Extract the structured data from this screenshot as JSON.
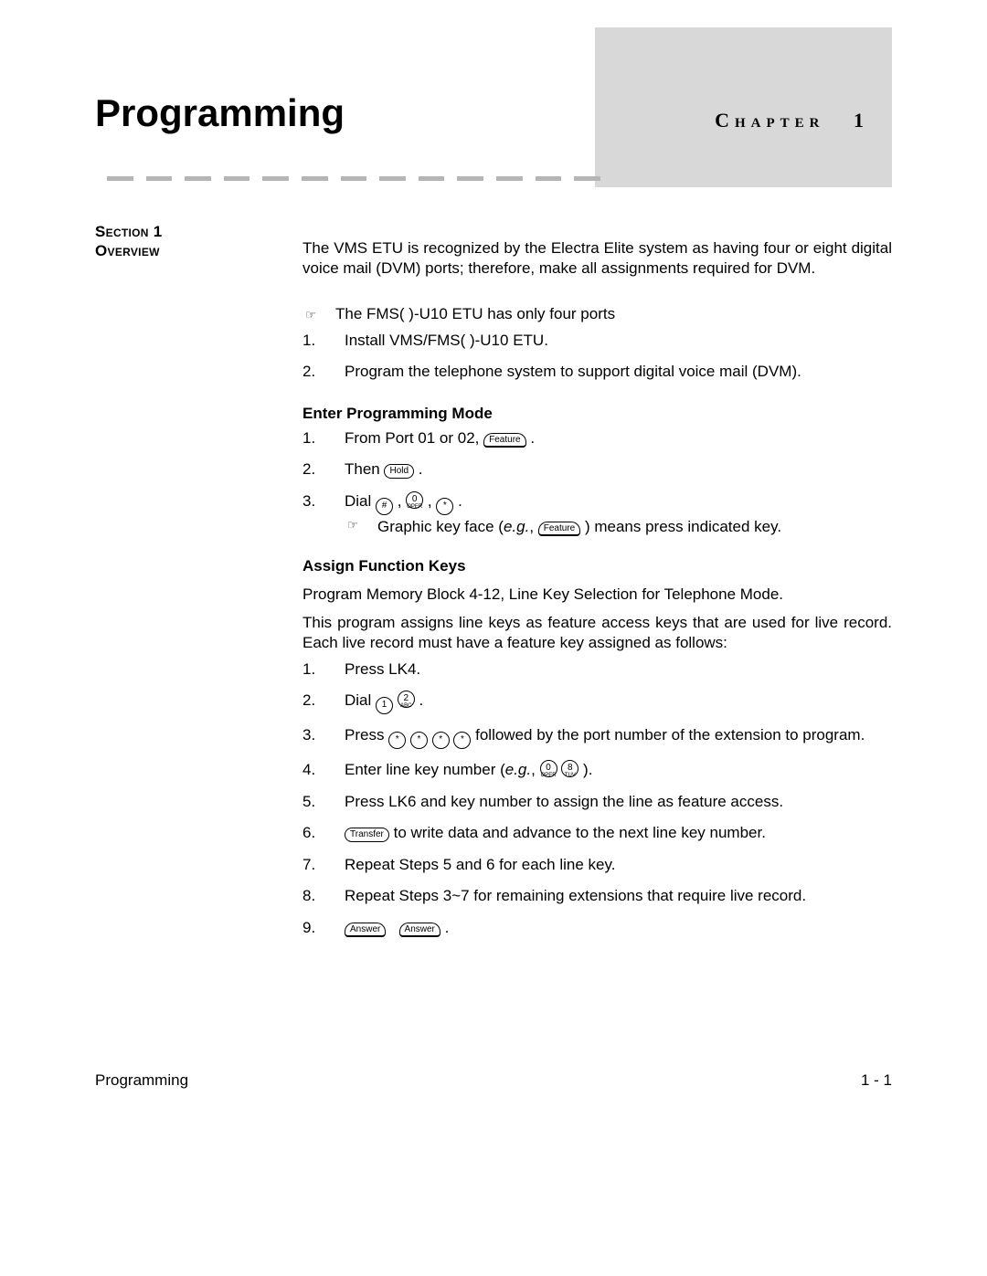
{
  "header": {
    "title": "Programming",
    "chapter_label": "Chapter",
    "chapter_number": "1"
  },
  "section": {
    "label": "Section 1",
    "name": "Overview"
  },
  "overview_para": "The VMS ETU is recognized by the Electra Elite system as having four or eight digital voice mail (DVM) ports; therefore, make all assignments required for DVM.",
  "note1": "The FMS( )-U10 ETU has only four ports",
  "list1": {
    "items": [
      {
        "n": "1.",
        "t": "Install VMS/FMS( )-U10 ETU."
      },
      {
        "n": "2.",
        "t": "Program the telephone system to support digital voice mail (DVM)."
      }
    ]
  },
  "enter_mode_heading": "Enter Programming Mode",
  "list2": {
    "items": [
      {
        "n": "1.",
        "pre": "From Port 01 or 02, ",
        "key": "Feature",
        "post": "."
      },
      {
        "n": "2.",
        "pre": "Then ",
        "key": "Hold",
        "post": "."
      },
      {
        "n": "3.",
        "pre": "Dial ",
        "keys": [
          "#",
          "0",
          "*"
        ],
        "keysubs": [
          "",
          "OPER",
          ""
        ],
        "post": "."
      }
    ]
  },
  "note2": {
    "pre": "Graphic key face (",
    "eg": "e.g.",
    "mid": ", ",
    "key": "Feature",
    "post": ")  means press indicated key."
  },
  "assign_heading": "Assign Function Keys",
  "mb_para": "Program Memory Block 4-12, Line Key Selection for Telephone Mode.",
  "assign_para": "This program assigns line keys as feature access keys that are used for live record.  Each live record must have a feature key assigned as follows:",
  "list3": {
    "items": [
      {
        "n": "1.",
        "pre": "Press LK4."
      },
      {
        "n": "2.",
        "pre": "Dial  ",
        "roundkeys": [
          {
            "t": "1",
            "s": ""
          },
          {
            "t": "2",
            "s": "ABC"
          }
        ],
        "post": " ."
      },
      {
        "n": "3.",
        "pre": "Press ",
        "roundkeys": [
          {
            "t": "*",
            "s": ""
          },
          {
            "t": "*",
            "s": ""
          },
          {
            "t": "*",
            "s": ""
          },
          {
            "t": "*",
            "s": ""
          }
        ],
        "post": "  followed by the port number of the extension to program."
      },
      {
        "n": "4.",
        "pre": "Enter line key number (",
        "eg": "e.g.",
        "mid": ",  ",
        "roundkeys": [
          {
            "t": "0",
            "s": "OPER"
          },
          {
            "t": "8",
            "s": "TUV"
          }
        ],
        "post": " )."
      },
      {
        "n": "5.",
        "pre": "Press LK6 and key number to assign the line as feature access."
      },
      {
        "n": "6.",
        "leadkey": "Transfer",
        "pre": " to write data and advance to the next line key number."
      },
      {
        "n": "7.",
        "pre": "Repeat Steps 5 and 6 for each line key."
      },
      {
        "n": "8.",
        "pre": "Repeat Steps 3~7 for remaining extensions that require live record."
      },
      {
        "n": "9.",
        "answerkeys": [
          "Answer",
          "Answer"
        ],
        "post": " ."
      }
    ]
  },
  "footer": {
    "left": "Programming",
    "right": "1 - 1"
  }
}
